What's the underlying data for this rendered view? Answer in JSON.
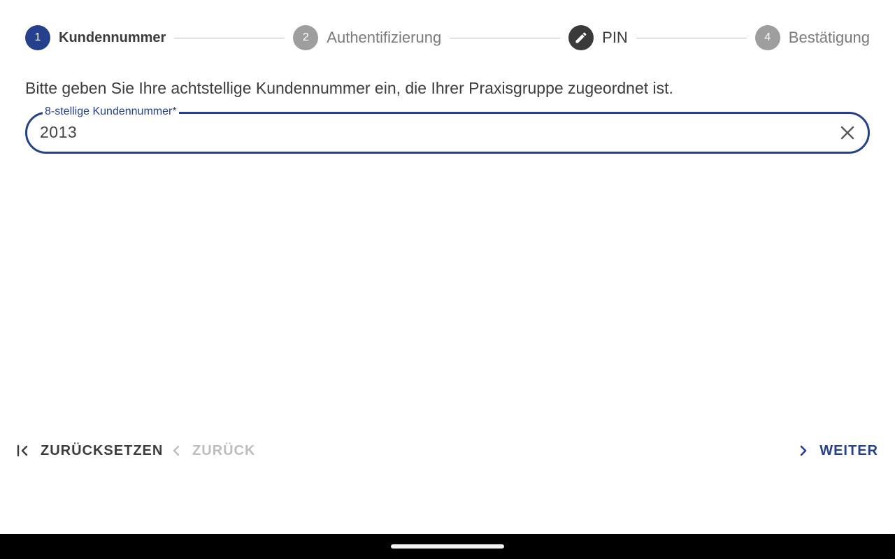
{
  "stepper": {
    "steps": [
      {
        "number": "1",
        "label": "Kundennummer",
        "state": "current"
      },
      {
        "number": "2",
        "label": "Authentifizierung",
        "state": "inactive"
      },
      {
        "number": "",
        "label": "PIN",
        "state": "edit",
        "icon": "pencil-icon"
      },
      {
        "number": "4",
        "label": "Bestätigung",
        "state": "inactive"
      }
    ]
  },
  "form": {
    "instruction": "Bitte geben Sie Ihre achtstellige Kundennummer ein, die Ihrer Praxisgruppe zugeordnet ist.",
    "customer_number": {
      "label": "8-stellige Kundennummer*",
      "value": "2013",
      "clear_icon": "close-icon"
    }
  },
  "navigation": {
    "reset_label": "ZURÜCKSETZEN",
    "back_label": "ZURÜCK",
    "next_label": "WEITER"
  },
  "colors": {
    "accent": "#26408b",
    "inactive": "#9e9e9e",
    "disabled_text": "#bdbdbd",
    "edit_step": "#3a3a3a"
  }
}
